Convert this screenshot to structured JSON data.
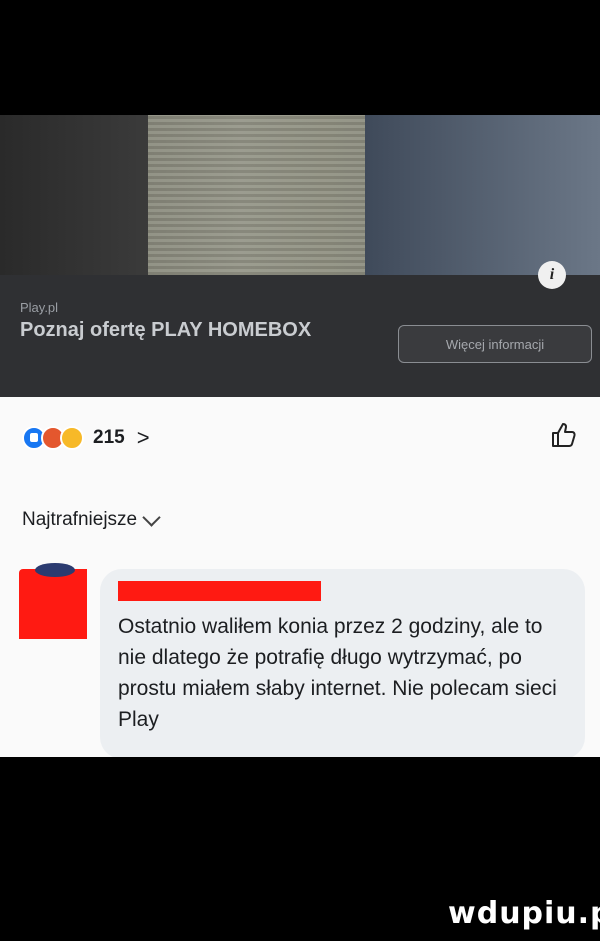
{
  "ad": {
    "source": "Play.pl",
    "title": "Poznaj ofertę PLAY HOMEBOX",
    "cta_label": "Więcej informacji",
    "info_label": "i"
  },
  "post": {
    "reactions": [
      "like-icon",
      "angry-icon",
      "sad-icon"
    ],
    "reaction_count": "215",
    "count_chevron": ">"
  },
  "comments": {
    "sort_label": "Najtrafniejsze",
    "items": [
      {
        "text": "Ostatnio waliłem konia przez 2 godziny, ale to nie dlatego że potrafię długo wytrzymać, po prostu miałem słaby internet. Nie polecam sieci Play"
      }
    ]
  },
  "watermark": "wdupiu.pl",
  "colors": {
    "redaction": "#ff1a12",
    "like_blue": "#1877f2",
    "bubble_bg": "#eceff2"
  }
}
